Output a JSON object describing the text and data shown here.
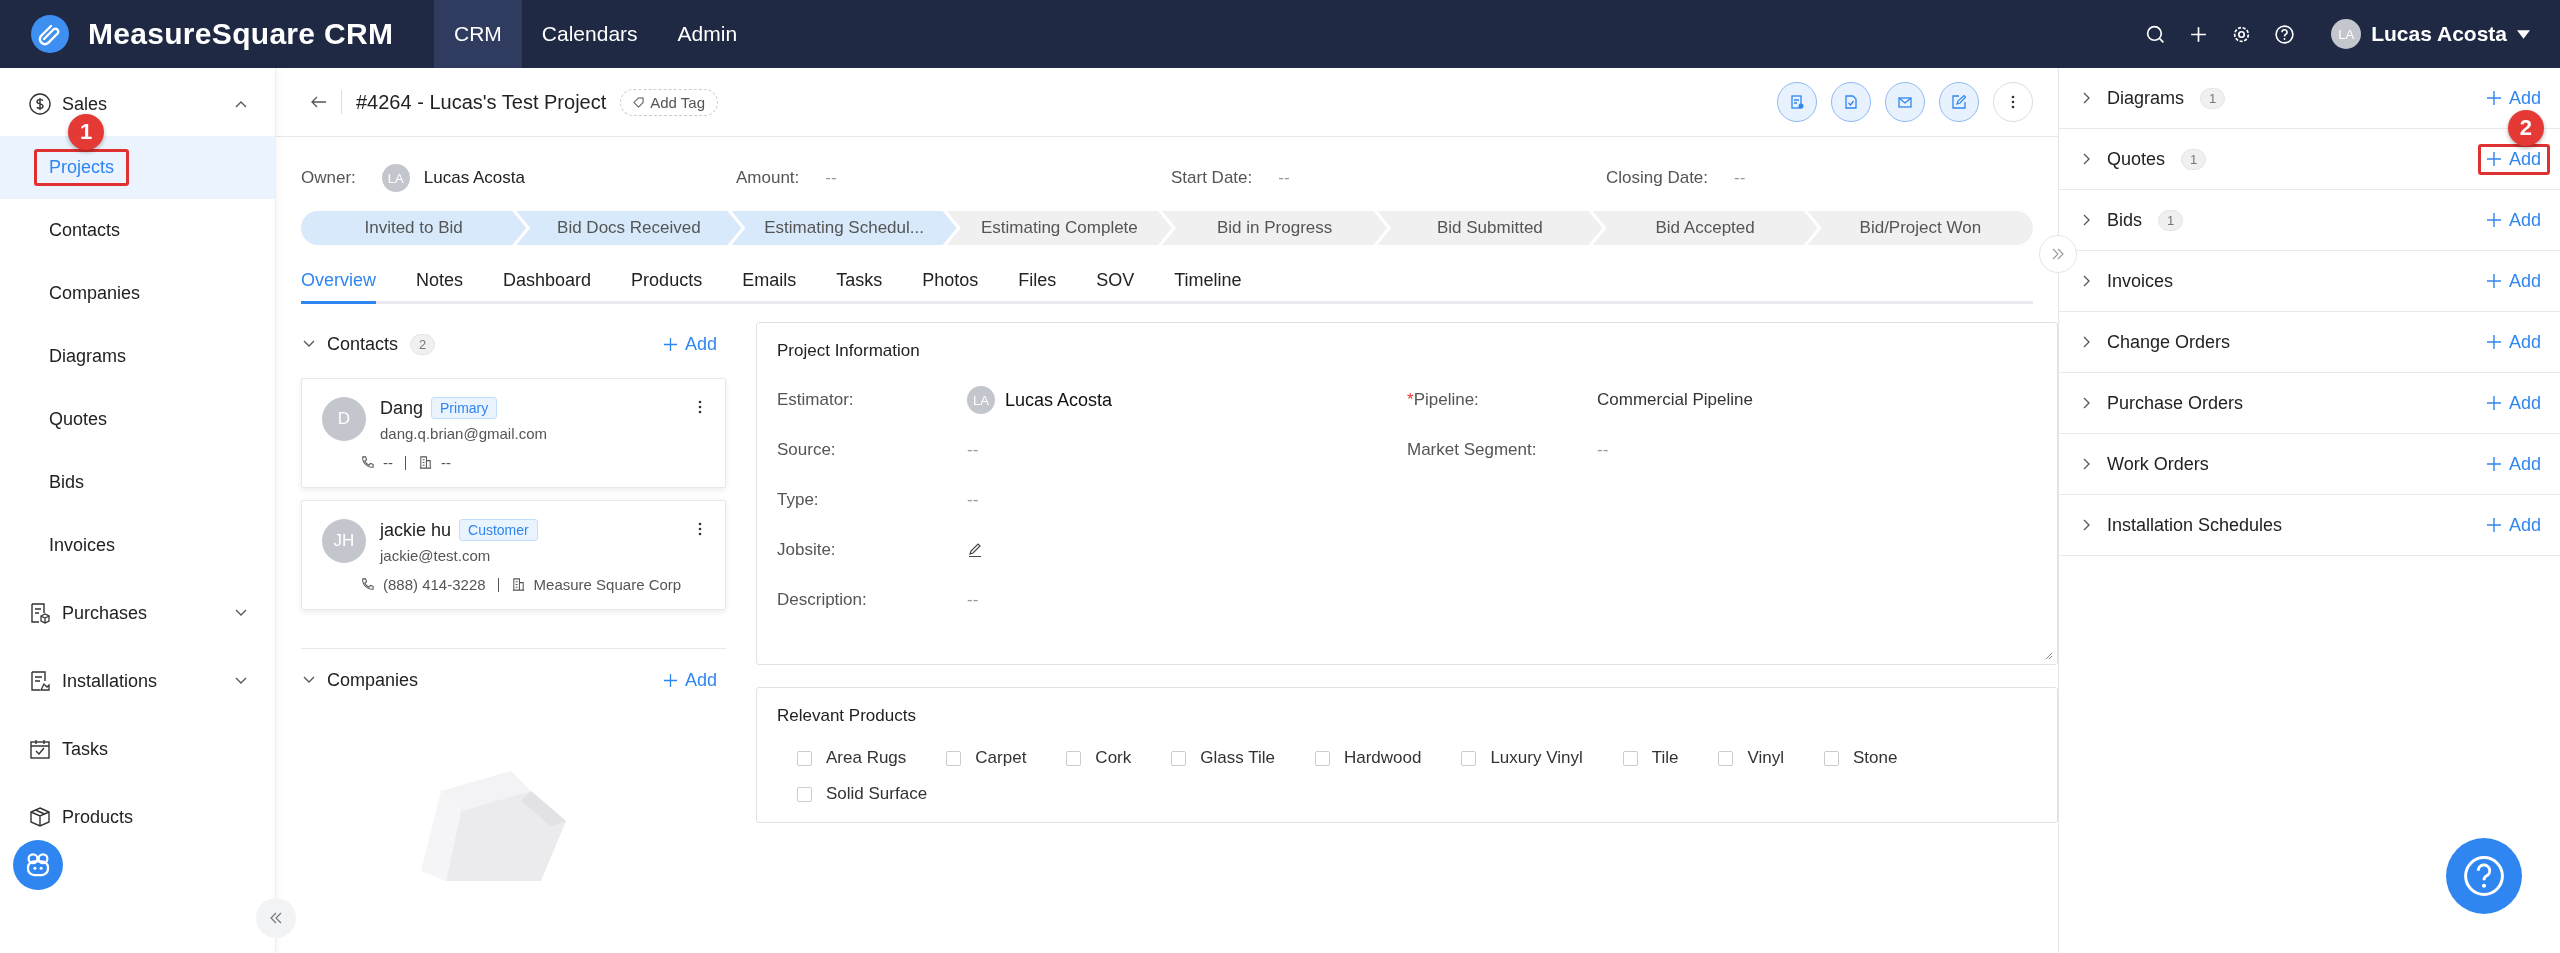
{
  "app": {
    "name": "MeasureSquare CRM"
  },
  "nav": [
    {
      "label": "CRM",
      "selected": true
    },
    {
      "label": "Calendars",
      "selected": false
    },
    {
      "label": "Admin",
      "selected": false
    }
  ],
  "user": {
    "initials": "LA",
    "name": "Lucas Acosta"
  },
  "sidebar": [
    {
      "kind": "group",
      "label": "Sales",
      "expanded": true,
      "children": [
        {
          "label": "Projects",
          "selected": true,
          "callout": "1"
        },
        {
          "label": "Contacts",
          "selected": false
        },
        {
          "label": "Companies",
          "selected": false
        },
        {
          "label": "Diagrams",
          "selected": false
        },
        {
          "label": "Quotes",
          "selected": false
        },
        {
          "label": "Bids",
          "selected": false
        },
        {
          "label": "Invoices",
          "selected": false
        }
      ]
    },
    {
      "kind": "group",
      "label": "Purchases",
      "expanded": false
    },
    {
      "kind": "group",
      "label": "Installations",
      "expanded": false
    },
    {
      "kind": "link",
      "label": "Tasks"
    },
    {
      "kind": "link",
      "label": "Products"
    }
  ],
  "project": {
    "title": "#4264 - Lucas's Test Project",
    "add_tag": "Add Tag",
    "summary": [
      {
        "label": "Owner:",
        "kind": "person",
        "initials": "LA",
        "value": "Lucas Acosta"
      },
      {
        "label": "Amount:",
        "kind": "text",
        "value": "--"
      },
      {
        "label": "Start Date:",
        "kind": "text",
        "value": "--"
      },
      {
        "label": "Closing Date:",
        "kind": "text",
        "value": "--"
      }
    ],
    "stages": [
      {
        "label": "Invited to Bid",
        "done": true
      },
      {
        "label": "Bid Docs Received",
        "done": true
      },
      {
        "label": "Estimating Schedul...",
        "done": true
      },
      {
        "label": "Estimating Complete",
        "done": false
      },
      {
        "label": "Bid in Progress",
        "done": false
      },
      {
        "label": "Bid Submitted",
        "done": false
      },
      {
        "label": "Bid Accepted",
        "done": false
      },
      {
        "label": "Bid/Project Won",
        "done": false
      }
    ],
    "tabs": [
      {
        "label": "Overview",
        "selected": true
      },
      {
        "label": "Notes",
        "selected": false
      },
      {
        "label": "Dashboard",
        "selected": false
      },
      {
        "label": "Products",
        "selected": false
      },
      {
        "label": "Emails",
        "selected": false
      },
      {
        "label": "Tasks",
        "selected": false
      },
      {
        "label": "Photos",
        "selected": false
      },
      {
        "label": "Files",
        "selected": false
      },
      {
        "label": "SOV",
        "selected": false
      },
      {
        "label": "Timeline",
        "selected": false
      }
    ]
  },
  "contacts": {
    "title": "Contacts",
    "count": "2",
    "add": "Add",
    "items": [
      {
        "initials": "D",
        "name": "Dang",
        "tag": "Primary",
        "email": "dang.q.brian@gmail.com",
        "phone": "--",
        "company": "--"
      },
      {
        "initials": "JH",
        "name": "jackie hu",
        "tag": "Customer",
        "email": "jackie@test.com",
        "phone": "(888) 414-3228",
        "company": "Measure Square Corp"
      }
    ]
  },
  "companies": {
    "title": "Companies",
    "add": "Add"
  },
  "project_info": {
    "title": "Project Information",
    "rows": [
      [
        {
          "label": "Estimator:",
          "kind": "person",
          "initials": "LA",
          "value": "Lucas Acosta"
        },
        {
          "label": "Pipeline:",
          "marker": "*",
          "kind": "text",
          "value": "Commercial Pipeline"
        }
      ],
      [
        {
          "label": "Source:",
          "kind": "empty",
          "value": "--"
        },
        {
          "label": "Market Segment:",
          "kind": "empty",
          "value": "--"
        }
      ],
      [
        {
          "label": "Type:",
          "kind": "empty",
          "value": "--"
        }
      ],
      [
        {
          "label": "Jobsite:",
          "kind": "edit"
        }
      ],
      [
        {
          "label": "Description:",
          "kind": "empty",
          "value": "--"
        }
      ]
    ]
  },
  "relevant_products": {
    "title": "Relevant Products",
    "items": [
      {
        "label": "Area Rugs",
        "checked": false
      },
      {
        "label": "Carpet",
        "checked": false
      },
      {
        "label": "Cork",
        "checked": false
      },
      {
        "label": "Glass Tile",
        "checked": false
      },
      {
        "label": "Hardwood",
        "checked": false
      },
      {
        "label": "Luxury Vinyl",
        "checked": false
      },
      {
        "label": "Tile",
        "checked": false
      },
      {
        "label": "Vinyl",
        "checked": false
      },
      {
        "label": "Stone",
        "checked": false
      },
      {
        "label": "Solid Surface",
        "checked": false
      }
    ]
  },
  "related": [
    {
      "label": "Diagrams",
      "count": "1",
      "add": "Add"
    },
    {
      "label": "Quotes",
      "count": "1",
      "add": "Add",
      "callout": "2"
    },
    {
      "label": "Bids",
      "count": "1",
      "add": "Add"
    },
    {
      "label": "Invoices",
      "add": "Add"
    },
    {
      "label": "Change Orders",
      "add": "Add"
    },
    {
      "label": "Purchase Orders",
      "add": "Add"
    },
    {
      "label": "Work Orders",
      "add": "Add"
    },
    {
      "label": "Installation Schedules",
      "add": "Add"
    }
  ]
}
